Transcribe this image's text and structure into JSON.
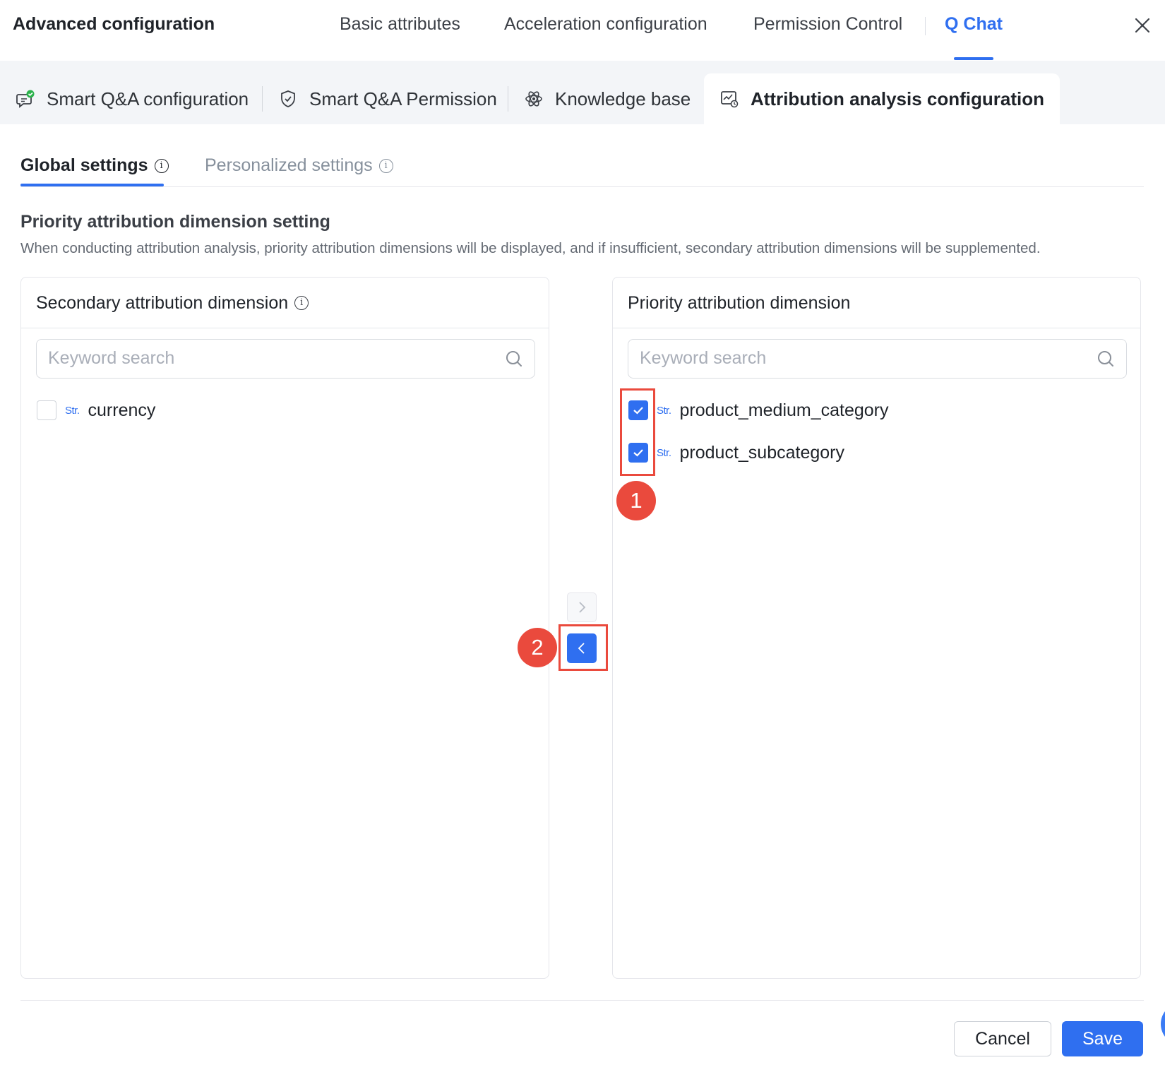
{
  "header": {
    "title": "Advanced configuration",
    "tabs": [
      {
        "label": "Basic attributes"
      },
      {
        "label": "Acceleration configuration"
      },
      {
        "label": "Permission Control"
      },
      {
        "label": "Q Chat",
        "active": true
      }
    ],
    "close_icon": "close-icon"
  },
  "subtabs": [
    {
      "label": "Smart Q&A configuration",
      "icon": "chat-check-icon"
    },
    {
      "label": "Smart Q&A Permission",
      "icon": "shield-icon"
    },
    {
      "label": "Knowledge base",
      "icon": "atom-icon"
    },
    {
      "label": "Attribution analysis configuration",
      "icon": "analysis-chart-icon",
      "active": true
    }
  ],
  "settings_tabs": [
    {
      "label": "Global settings",
      "active": true
    },
    {
      "label": "Personalized settings"
    }
  ],
  "section": {
    "title": "Priority attribution dimension setting",
    "description": "When conducting attribution analysis, priority attribution dimensions will be displayed, and if insufficient, secondary attribution dimensions will be supplemented."
  },
  "left_panel": {
    "title": "Secondary attribution dimension",
    "search_placeholder": "Keyword search",
    "items": [
      {
        "type": "Str.",
        "label": "currency",
        "checked": false
      }
    ]
  },
  "right_panel": {
    "title": "Priority attribution dimension",
    "search_placeholder": "Keyword search",
    "items": [
      {
        "type": "Str.",
        "label": "product_medium_category",
        "checked": true
      },
      {
        "type": "Str.",
        "label": "product_subcategory",
        "checked": true
      }
    ]
  },
  "annotations": {
    "step1": "1",
    "step2": "2",
    "color": "#ea4a3d"
  },
  "footer": {
    "cancel_label": "Cancel",
    "save_label": "Save"
  },
  "colors": {
    "accent": "#2f6ff0",
    "annotation": "#ea4a3d"
  }
}
